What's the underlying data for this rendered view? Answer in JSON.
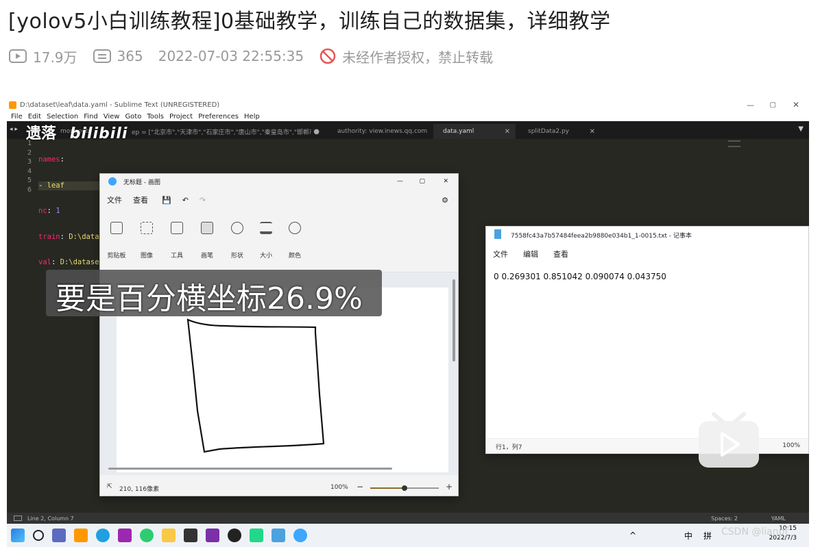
{
  "article": {
    "title": "[yolov5小白训练教程]0基础教学，训练自己的数据集，详细教学",
    "views": "17.9万",
    "comments": "365",
    "datetime": "2022-07-03 22:55:35",
    "copyright": "未经作者授权，禁止转载"
  },
  "sublime": {
    "window_title": "D:\\dataset\\leaf\\data.yaml - Sublime Text (UNREGISTERED)",
    "menu": [
      "File",
      "Edit",
      "Selection",
      "Find",
      "View",
      "Goto",
      "Tools",
      "Project",
      "Preferences",
      "Help"
    ],
    "tabs": [
      {
        "label": "mongodb"
      },
      {
        "label": "ep = [\"北京市\",\"天津市\",\"石家庄市\",\"唐山市\",\"秦皇岛市\",\"邯郸市\","
      },
      {
        "label": "authority: view.inews.qq.com"
      },
      {
        "label": "data.yaml"
      },
      {
        "label": "splitData2.py"
      }
    ],
    "line_numbers": [
      "1",
      "2",
      "3",
      "4",
      "5",
      "6"
    ],
    "code": [
      {
        "key": "names",
        "sep": ":",
        "val": ""
      },
      {
        "key": "- ",
        "sep": "",
        "val": "leaf"
      },
      {
        "key": "nc",
        "sep": ": ",
        "val": "1"
      },
      {
        "key": "train",
        "sep": ": ",
        "val": "D:\\dataset\\leaf\\train"
      },
      {
        "key": "val",
        "sep": ": ",
        "val": "D:\\dataset"
      },
      {
        "key": "",
        "sep": "",
        "val": ""
      }
    ],
    "status_left": "Line 2, Column 7",
    "status_spaces": "Spaces: 2",
    "status_syntax": "YAML"
  },
  "paint": {
    "window_title": "无标题 - 画图",
    "menu": [
      "文件",
      "查看"
    ],
    "groups": [
      "剪贴板",
      "图像",
      "工具",
      "画笔",
      "形状",
      "大小",
      "颜色"
    ],
    "coords": "210, 116像素",
    "zoom": "100%",
    "zoom_level": 0.5
  },
  "notepad": {
    "window_title": "7558fc43a7b57484feea2b9880e034b1_1-0015.txt - 记事本",
    "menu": [
      "文件",
      "编辑",
      "查看"
    ],
    "content": "0 0.269301 0.851042 0.090074 0.043750",
    "cursor": "行1，列7",
    "zoom": "100%"
  },
  "overlay": {
    "subtitle": "要是百分横坐标26.9%",
    "watermark_text": "遗落",
    "watermark_logo": "bilibili",
    "csdn": "CSDN @lianpf"
  },
  "taskbar": {
    "ime": [
      "中",
      "拼"
    ],
    "time": "10:15",
    "date": "2022/7/3"
  },
  "colors": {
    "sublime_bg": "#272822",
    "keyword": "#f92672",
    "string": "#e6db74",
    "number": "#ae81ff"
  }
}
